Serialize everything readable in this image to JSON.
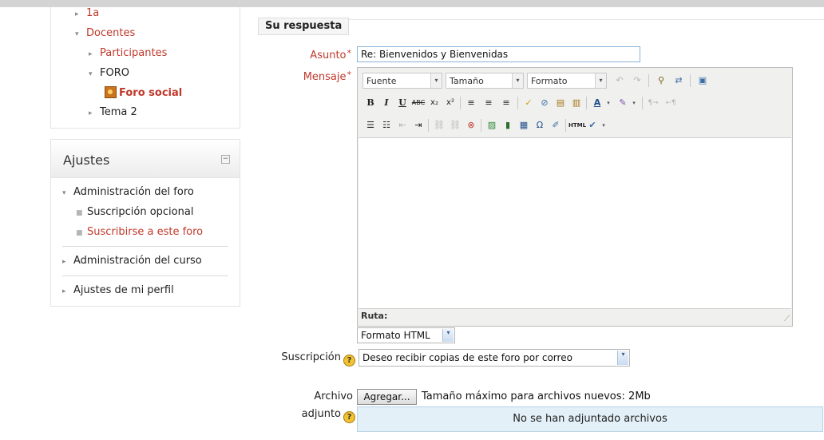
{
  "nav": {
    "items": [
      {
        "label": "1a",
        "arrow": "▸",
        "red": true
      },
      {
        "label": "Docentes",
        "arrow": "▾",
        "red": true
      },
      {
        "label": "Participantes",
        "arrow": "▸",
        "red": true
      },
      {
        "label": "FORO",
        "arrow": "▾",
        "red": false
      },
      {
        "label": "Foro social",
        "red": true,
        "bold": true
      },
      {
        "label": "Tema 2",
        "arrow": "▸",
        "red": false
      }
    ]
  },
  "settings": {
    "title": "Ajustes",
    "collapse": "−",
    "forum_admin": "Administración del foro",
    "opt_subscription": "Suscripción opcional",
    "subscribe": "Suscribirse a este foro",
    "course_admin": "Administración del curso",
    "profile": "Ajustes de mi perfil"
  },
  "form": {
    "legend": "Su respuesta",
    "asunto_label": "Asunto",
    "asunto_value": "Re: Bienvenidos y Bienvenidas",
    "mensaje_label": "Mensaje",
    "required_mark": "*",
    "editor": {
      "font": "Fuente",
      "size": "Tamaño",
      "format": "Formato",
      "path_label": "Ruta:"
    },
    "text_format": "Formato HTML",
    "suscripcion_label": "Suscripción",
    "suscripcion_value": "Deseo recibir copias de este foro por correo",
    "archivo_label_1": "Archivo",
    "archivo_label_2": "adjunto",
    "add_button": "Agregar...",
    "max_size": "Tamaño máximo para archivos nuevos: 2Mb",
    "no_files": "No se han adjuntado archivos"
  },
  "icons": {
    "help": "?",
    "dropdown": "▾"
  },
  "colors": {
    "link_red": "#c0392b",
    "files_bg": "#e3f0f8"
  }
}
